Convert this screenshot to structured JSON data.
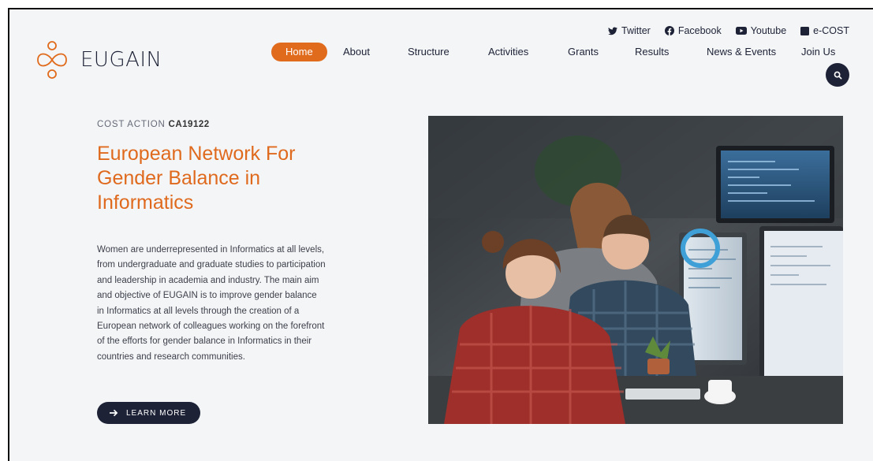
{
  "brand": {
    "name": "EUGAIN"
  },
  "social": [
    {
      "label": "Twitter",
      "icon": "twitter-icon"
    },
    {
      "label": "Facebook",
      "icon": "facebook-icon"
    },
    {
      "label": "Youtube",
      "icon": "youtube-icon"
    },
    {
      "label": "e-COST",
      "icon": "square-icon"
    }
  ],
  "nav": [
    {
      "label": "Home",
      "active": true
    },
    {
      "label": "About"
    },
    {
      "label": "Structure"
    },
    {
      "label": "Activities"
    },
    {
      "label": "Grants"
    },
    {
      "label": "Results"
    },
    {
      "label": "News & Events"
    },
    {
      "label": "Join Us"
    }
  ],
  "hero": {
    "eyebrow_prefix": "COST ACTION",
    "eyebrow_code": "CA19122",
    "title": "European Network For Gender Balance in Informatics",
    "description": "Women are underrepresented in Informatics at all levels, from undergraduate and graduate studies to participation and leadership in academia and industry. The main aim and objective of EUGAIN is to improve gender balance in Informatics at all levels through the creation of a European network of colleagues working on the forefront of the efforts for gender balance in Informatics in their countries and research communities.",
    "cta_label": "LEARN MORE"
  },
  "colors": {
    "accent": "#e06b1c",
    "dark": "#1d2236",
    "background": "#f4f5f7"
  }
}
